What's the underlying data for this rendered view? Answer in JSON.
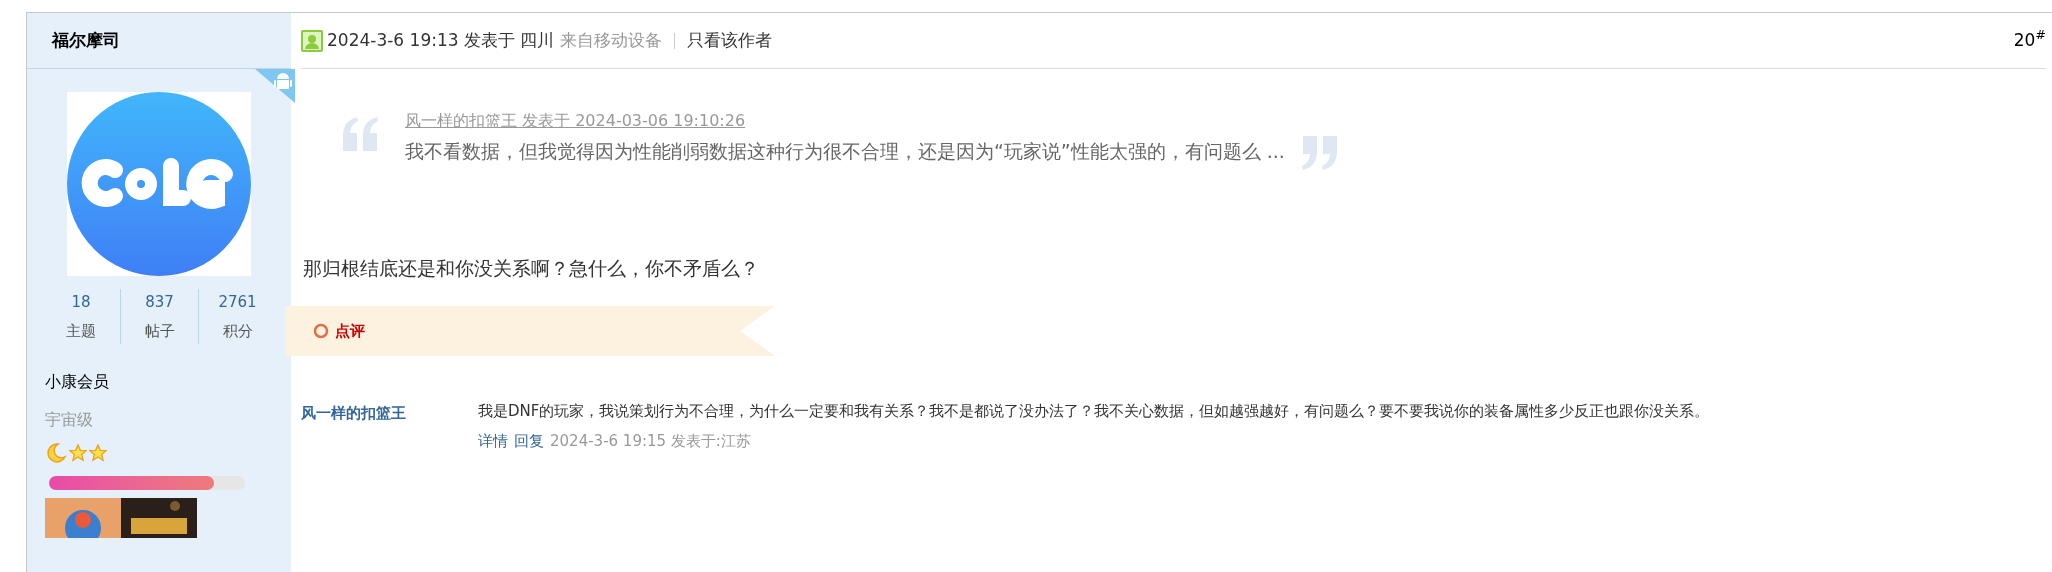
{
  "author": {
    "name": "福尔摩司",
    "stats": [
      {
        "value": "18",
        "label": "主题"
      },
      {
        "value": "837",
        "label": "帖子"
      },
      {
        "value": "2761",
        "label": "积分"
      }
    ],
    "group": "小康会员",
    "rank": "宇宙级",
    "progress": {
      "level": 0.84
    }
  },
  "post": {
    "date_line": "2024-3-6 19:13 发表于 四川",
    "source": "来自移动设备",
    "filter_link": "只看该作者",
    "floor": "20$^{#}$",
    "quote": {
      "byline": "风一样的扣篮王 发表于 2024-03-06 19:10:26",
      "text": "我不看数据，但我觉得因为性能削弱数据这种行为很不合理，还是因为“玩家说”性能太强的，有问题么 ..."
    },
    "body": "那归根结底还是和你没关系啊？急什么，你不矛盾么？",
    "comments_header": "点评",
    "comments": [
      {
        "user": "风一样的扣篮王",
        "text": "我是DNF的玩家，我说策划行为不合理，为什么一定要和我有关系？我不是都说了没办法了？我不关心数据，但如越强越好，有问题么？要不要我说你的装备属性多少反正也跟你没关系。",
        "detail_link": "详情",
        "reply_link": "回复",
        "time": "2024-3-6 19:15 发表于:江苏"
      }
    ]
  }
}
